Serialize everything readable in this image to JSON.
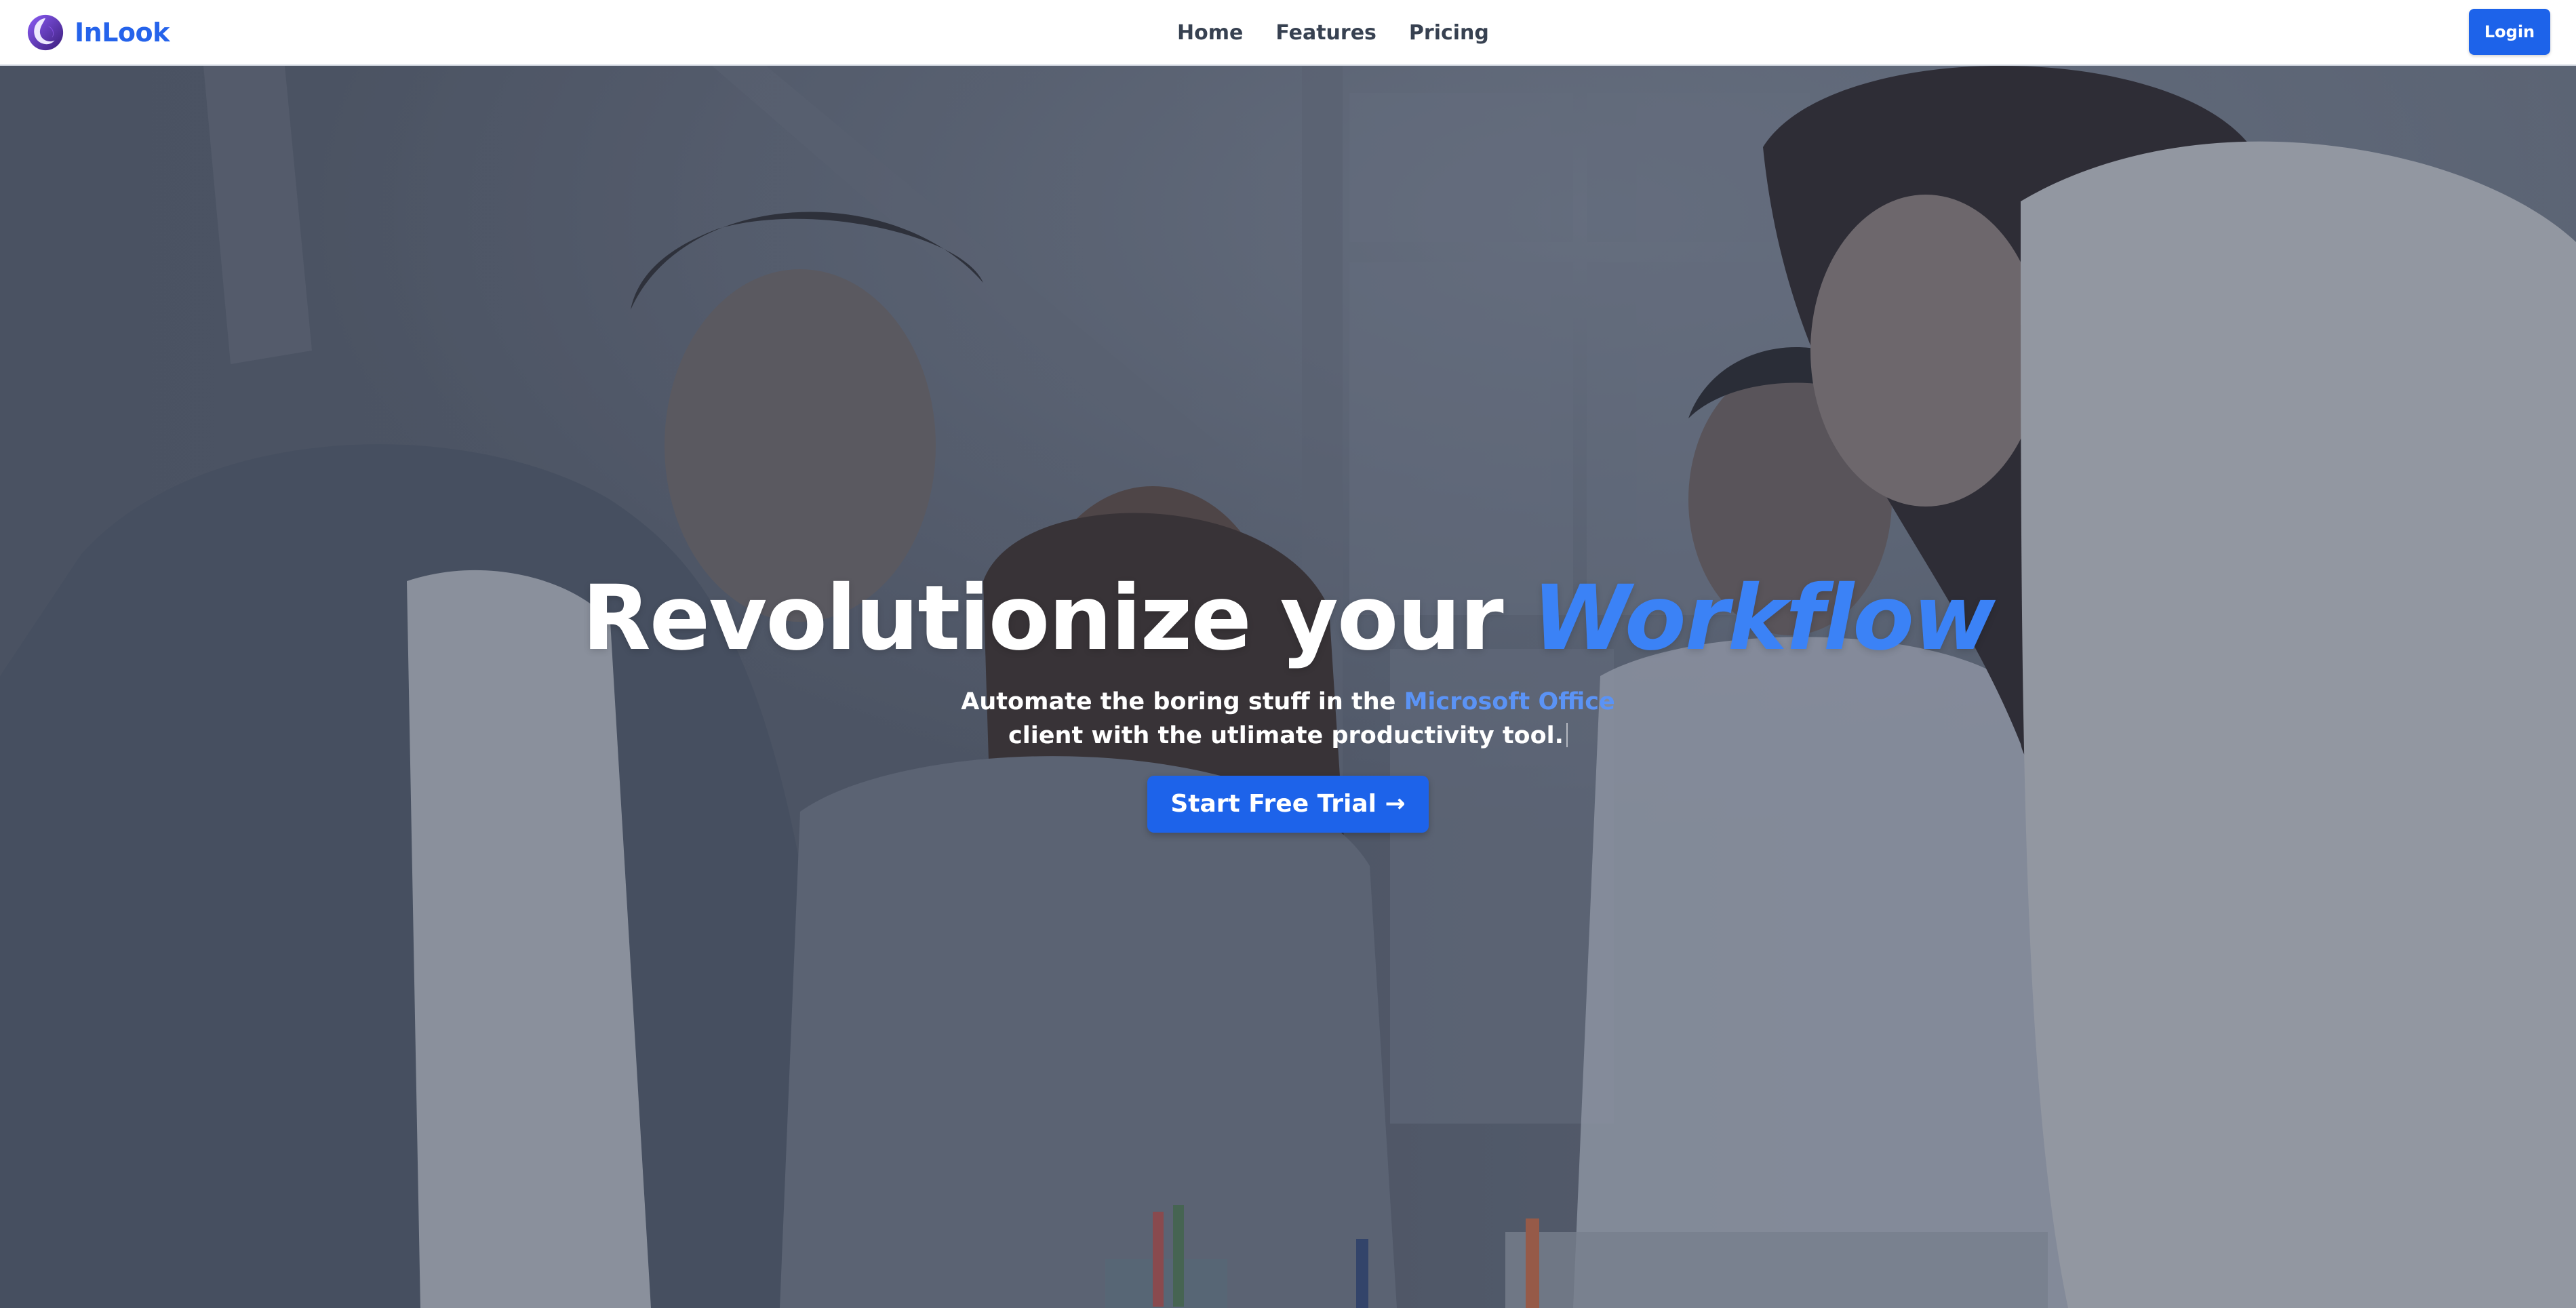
{
  "nav": {
    "brand": "InLook",
    "links": [
      "Home",
      "Features",
      "Pricing"
    ],
    "login_label": "Login"
  },
  "hero": {
    "title_main": "Revolutionize your",
    "title_accent": "Workflow",
    "subtitle_before": "Automate the boring stuff in the",
    "subtitle_accent": "Microsoft Office",
    "subtitle_after": "client with the utlimate productivity tool.",
    "cta_label": "Start Free Trial →"
  },
  "colors": {
    "brand_blue": "#2563eb",
    "button_blue": "#1d63ea",
    "accent_blue": "#3b82f6",
    "nav_text": "#374151",
    "overlay": "#343c4d"
  },
  "icons": {
    "brand_logo": "swirl-logo-icon",
    "cta_arrow": "arrow-right-icon"
  }
}
